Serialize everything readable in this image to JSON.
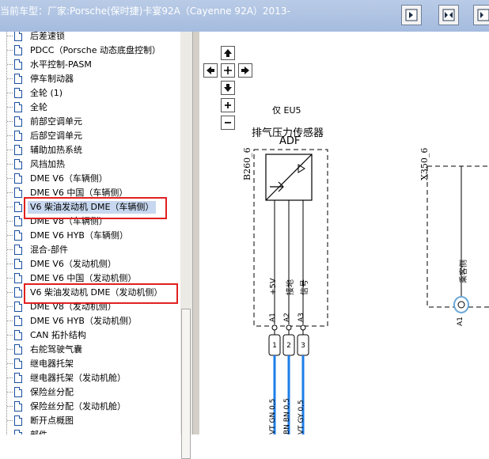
{
  "header": {
    "title": "当前车型：厂家:Porsche(保时捷)卡宴92A（Cayenne 92A）2013-"
  },
  "toolbar": {
    "buttons": [
      "single-page-view-icon",
      "two-page-view-icon",
      "multi-page-view-icon"
    ]
  },
  "tree": {
    "items": [
      "后差速锁",
      "PDCC（Porsche 动态底盘控制）",
      "水平控制-PASM",
      "停车制动器",
      "全轮 (1)",
      "全轮",
      "前部空调单元",
      "后部空调单元",
      "辅助加热系统",
      "风挡加热",
      "DME V6（车辆侧）",
      "DME V6 中国（车辆侧）",
      "V6 柴油发动机 DME（车辆侧）",
      "DME V8（车辆侧）",
      "DME V6 HYB（车辆侧）",
      "混合-部件",
      "DME V6（发动机侧）",
      "DME V6 中国（发动机侧）",
      "V6 柴油发动机 DME（发动机侧）",
      "DME V8（发动机侧）",
      "DME V6 HYB（发动机侧）",
      "CAN 拓扑结构",
      "右舵驾驶气囊",
      "继电器托架",
      "继电器托架（发动机舱）",
      "保险丝分配",
      "保险丝分配（发动机舱）",
      "断开点概图",
      "部件"
    ],
    "selected_index": 12
  },
  "diagram": {
    "variant": "仅 EU5",
    "component_name": "排气压力传感器",
    "component_code": "ADF",
    "left_ref": "B260_6",
    "right_ref": "X350_6",
    "pin_labels": [
      "+5V",
      "接地",
      "信号"
    ],
    "pin_ids": [
      "A1",
      "A2",
      "A3"
    ],
    "connector_numbers": [
      "1",
      "2",
      "3"
    ],
    "wire_labels": [
      "VT GN 0,5",
      "BN BN 0,5",
      "VT GY 0,5"
    ],
    "right_labels": [
      "乘客侧",
      "A1"
    ],
    "wire_color": "#1e7ee8"
  }
}
